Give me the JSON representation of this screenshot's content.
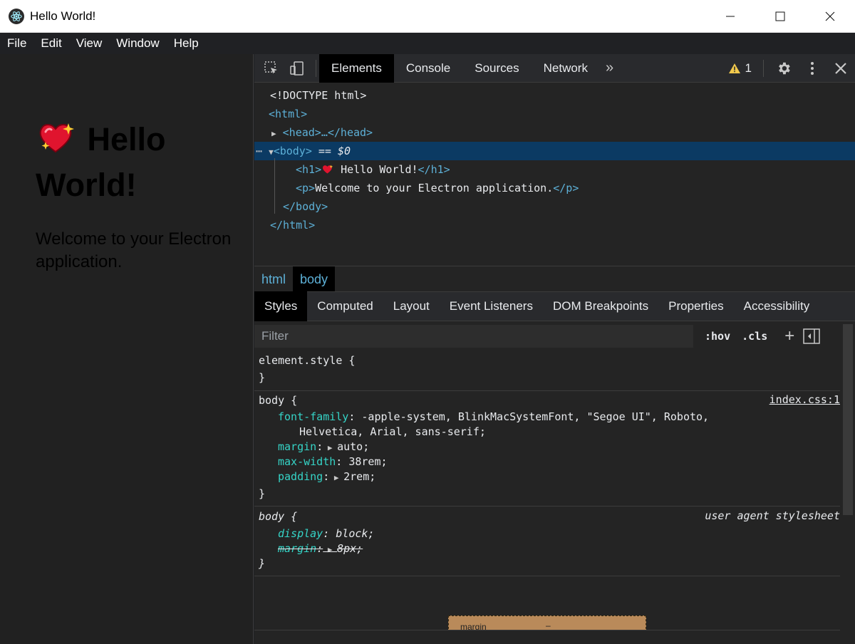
{
  "window": {
    "title": "Hello World!",
    "controls": {
      "minimize": "—",
      "maximize": "☐",
      "close": "✕"
    }
  },
  "menu": [
    "File",
    "Edit",
    "View",
    "Window",
    "Help"
  ],
  "page": {
    "heading": "Hello World!",
    "heading_emoji": "heart-sparkle",
    "paragraph": "Welcome to your Electron application."
  },
  "devtools": {
    "tabs": [
      "Elements",
      "Console",
      "Sources",
      "Network"
    ],
    "active_tab": "Elements",
    "more_tabs": "»",
    "warning_count": "1",
    "dom": {
      "doctype": "<!DOCTYPE html>",
      "html_open": "<html>",
      "head": "<head>…</head>",
      "body_open": "<body>",
      "body_marker": "== $0",
      "h1_open": "<h1>",
      "h1_text": " Hello World!",
      "h1_close": "</h1>",
      "p_open": "<p>",
      "p_text": "Welcome to your Electron application.",
      "p_close": "</p>",
      "body_close": "</body>",
      "html_close": "</html>",
      "selected_dots": "⋯"
    },
    "breadcrumbs": [
      "html",
      "body"
    ],
    "subtabs": [
      "Styles",
      "Computed",
      "Layout",
      "Event Listeners",
      "DOM Breakpoints",
      "Properties",
      "Accessibility"
    ],
    "filter": {
      "placeholder": "Filter",
      "hov": ":hov",
      "cls": ".cls",
      "plus": "+"
    },
    "rules": {
      "element_style": {
        "selector": "element.style {",
        "close": "}"
      },
      "body_author": {
        "selector": "body {",
        "source": "index.css:1",
        "props": [
          {
            "name": "font-family",
            "value": " -apple-system, BlinkMacSystemFont, \"Segoe UI\", Roboto,",
            "cont": "Helvetica, Arial, sans-serif;"
          },
          {
            "name": "margin",
            "value": "auto;"
          },
          {
            "name": "max-width",
            "value": " 38rem;"
          },
          {
            "name": "padding",
            "value": "2rem;"
          }
        ],
        "close": "}"
      },
      "body_ua": {
        "selector": "body {",
        "source": "user agent stylesheet",
        "props": [
          {
            "name": "display",
            "value": " block;"
          },
          {
            "name": "margin",
            "value": "8px;"
          }
        ],
        "close": "}"
      }
    },
    "boxmodel": {
      "label": "margin",
      "value": "–"
    }
  }
}
